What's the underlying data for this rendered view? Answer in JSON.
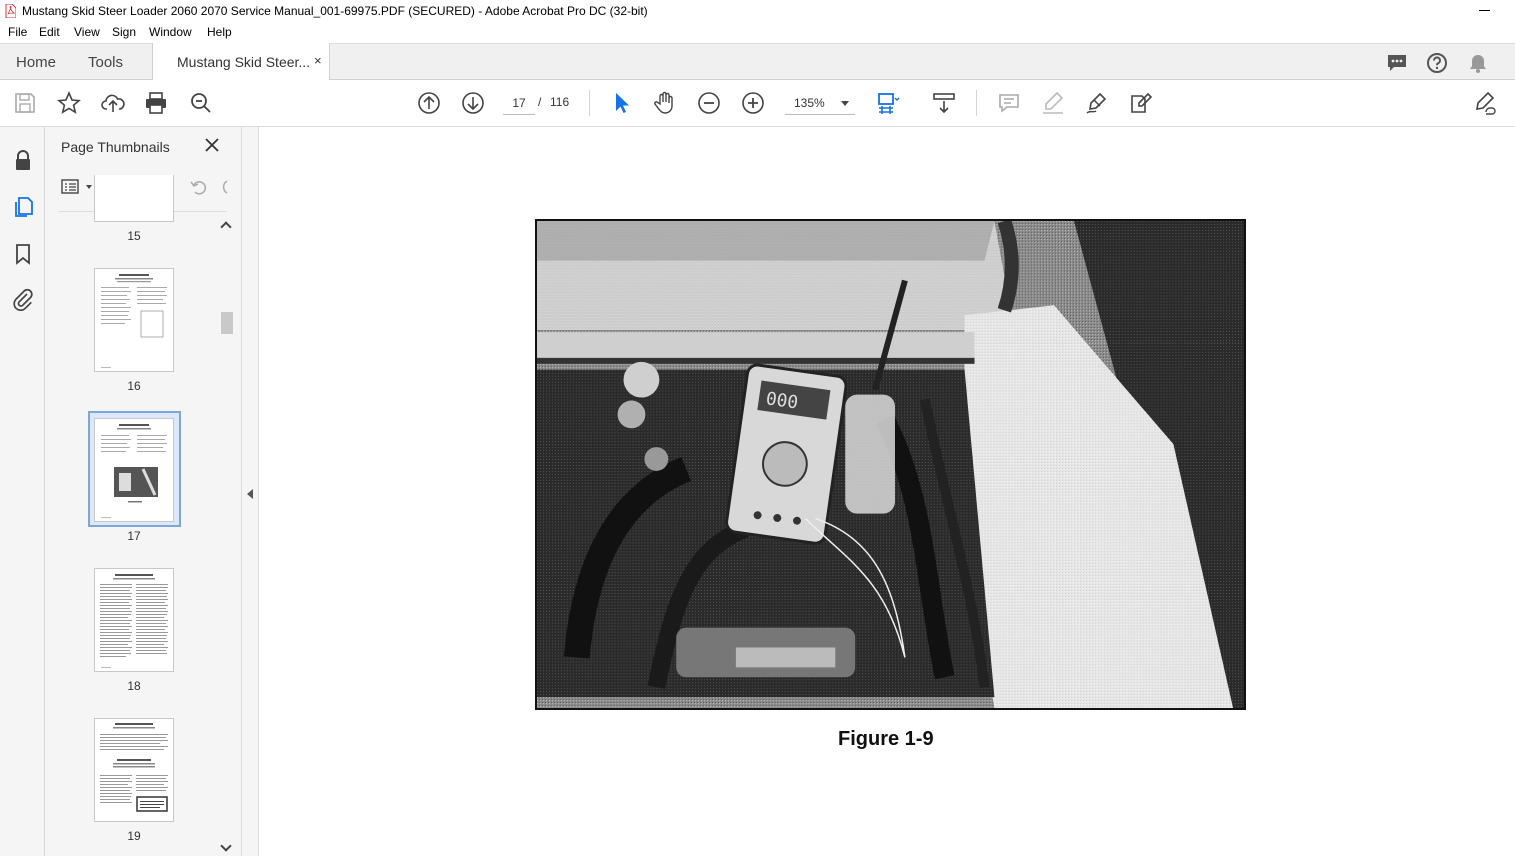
{
  "window": {
    "title": "Mustang Skid Steer Loader 2060 2070 Service Manual_001-69975.PDF (SECURED) - Adobe Acrobat Pro DC (32-bit)"
  },
  "menu": {
    "file": "File",
    "edit": "Edit",
    "view": "View",
    "sign": "Sign",
    "window": "Window",
    "help": "Help"
  },
  "tabs": {
    "home": "Home",
    "tools": "Tools",
    "document": "Mustang Skid Steer...",
    "close": "×"
  },
  "toolbar": {
    "current_page": "17",
    "page_separator": "/",
    "total_pages": "116",
    "zoom": "135%"
  },
  "thumbnail_panel": {
    "title": "Page Thumbnails",
    "thumbnails": [
      {
        "label": "15"
      },
      {
        "label": "16",
        "heading": "SAFETY EQUIPMENT"
      },
      {
        "label": "17",
        "heading": "SAFETY EQUIPMENT",
        "selected": true
      },
      {
        "label": "18",
        "heading": "GENERAL INFORMATION"
      },
      {
        "label": "19",
        "heading": "GENERAL INFORMATION",
        "subheading": "HYDRAULIC FLUIDS"
      }
    ]
  },
  "document": {
    "figure_caption": "Figure 1-9"
  },
  "colors": {
    "accent_blue": "#1473e6",
    "selection_border": "#7ea6d6",
    "acrobat_red": "#d7373f"
  }
}
